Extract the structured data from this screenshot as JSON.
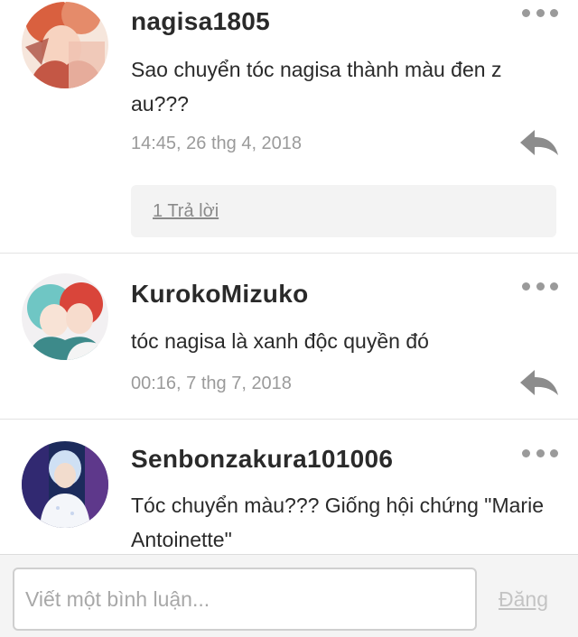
{
  "comments": [
    {
      "username": "nagisa1805",
      "text": "Sao chuyển tóc nagisa thành màu đen z au???",
      "timestamp": "14:45, 26 thg 4, 2018",
      "replies_label": "1 Trả lời",
      "avatar_icon": "anime-couple-avatar"
    },
    {
      "username": "KurokoMizuko",
      "text": "tóc nagisa là xanh độc quyền đó",
      "timestamp": "00:16, 7 thg 7, 2018",
      "avatar_icon": "anime-pair-avatar"
    },
    {
      "username": "Senbonzakura101006",
      "text": "Tóc chuyển màu???  Giống hội chứng \"Marie Antoinette\"",
      "avatar_icon": "person-photo-avatar"
    }
  ],
  "composer": {
    "placeholder": "Viết một bình luận...",
    "post_label": "Đăng"
  },
  "colors": {
    "username": "#2a2a2a",
    "meta_text": "#9a9a9a",
    "reply_box_bg": "#f3f3f3",
    "post_disabled": "#c3c3c3"
  }
}
